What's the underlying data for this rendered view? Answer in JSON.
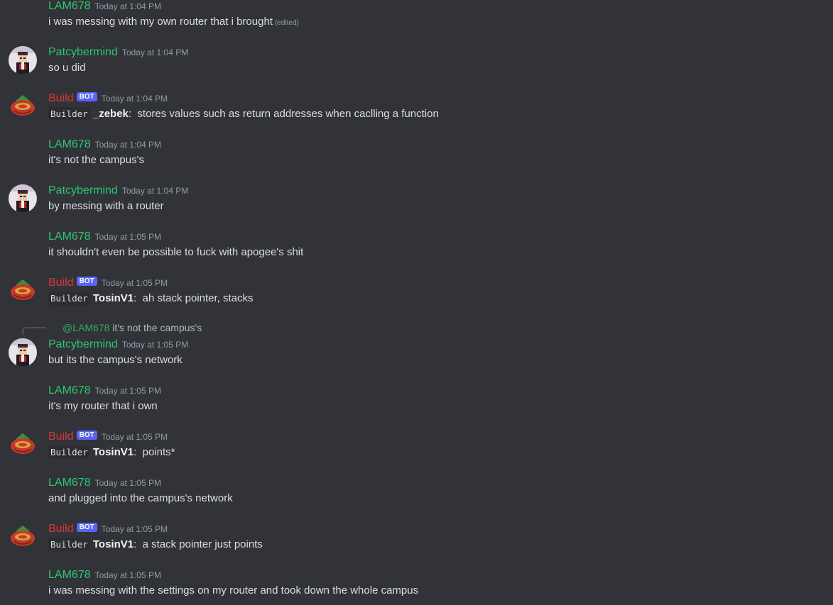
{
  "colors": {
    "lam": "#2dc770",
    "pat": "#2dc770",
    "build": "#da373c",
    "bg": "#313338"
  },
  "timestamps": {
    "t104": "Today at 1:04 PM",
    "t105": "Today at 1:05 PM"
  },
  "bot_tag": "BOT",
  "messages": [
    {
      "author": "LAM678",
      "time": "Today at 1:04 PM",
      "text": "i was messing with my own router that i brought",
      "edited": "(edited)"
    },
    {
      "author": "Patcybermind",
      "time": "Today at 1:04 PM",
      "text": "so u did"
    },
    {
      "author": "Build",
      "time": "Today at 1:04 PM",
      "code": "Builder",
      "user": "_zebek",
      "sep": ":",
      "text": "stores values such as return addresses when caclling a function"
    },
    {
      "author": "LAM678",
      "time": "Today at 1:04 PM",
      "text": "it's not the campus's"
    },
    {
      "author": "Patcybermind",
      "time": "Today at 1:04 PM",
      "text": "by messing with a router"
    },
    {
      "author": "LAM678",
      "time": "Today at 1:05 PM",
      "text": "it shouldn't even be possible to fuck with apogee's shit"
    },
    {
      "author": "Build",
      "time": "Today at 1:05 PM",
      "code": "Builder",
      "user": "TosinV1",
      "sep": ":",
      "text": "ah stack pointer, stacks"
    },
    {
      "author": "Patcybermind",
      "time": "Today at 1:05 PM",
      "reply_mention": "@LAM678",
      "reply_text": "it's not the campus's",
      "text": "but its the campus's network"
    },
    {
      "author": "LAM678",
      "time": "Today at 1:05 PM",
      "text": "it's my router that i own"
    },
    {
      "author": "Build",
      "time": "Today at 1:05 PM",
      "code": "Builder",
      "user": "TosinV1",
      "sep": ":",
      "text": "points*"
    },
    {
      "author": "LAM678",
      "time": "Today at 1:05 PM",
      "text": "and plugged into the campus's network"
    },
    {
      "author": "Build",
      "time": "Today at 1:05 PM",
      "code": "Builder",
      "user": "TosinV1",
      "sep": ":",
      "text": "a stack pointer just points"
    },
    {
      "author": "LAM678",
      "time": "Today at 1:05 PM",
      "text": "i was messing with the settings on my router and took down the whole campus"
    }
  ]
}
